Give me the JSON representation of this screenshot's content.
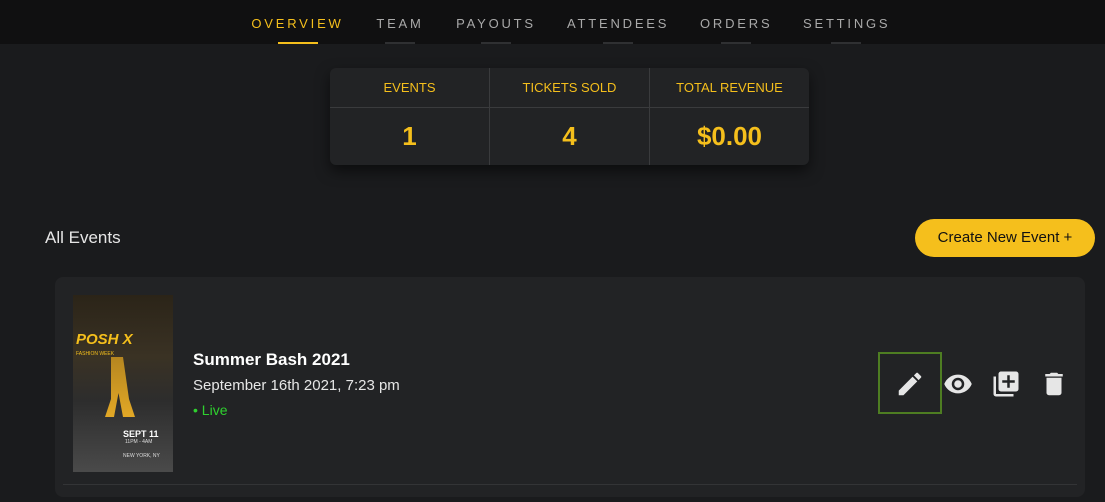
{
  "nav": {
    "tabs": [
      {
        "label": "OVERVIEW",
        "active": true
      },
      {
        "label": "TEAM"
      },
      {
        "label": "PAYOUTS"
      },
      {
        "label": "ATTENDEES"
      },
      {
        "label": "ORDERS"
      },
      {
        "label": "SETTINGS"
      }
    ]
  },
  "stats": [
    {
      "label": "EVENTS",
      "value": "1"
    },
    {
      "label": "TICKETS SOLD",
      "value": "4"
    },
    {
      "label": "TOTAL REVENUE",
      "value": "$0.00"
    }
  ],
  "events_section": {
    "title": "All Events",
    "create_label": "Create New Event +"
  },
  "event": {
    "name": "Summer Bash 2021",
    "datetime": "September 16th 2021, 7:23 pm",
    "status": "• Live",
    "poster": {
      "title": "POSH X",
      "subtitle": "FASHION WEEK",
      "date": "SEPT 11",
      "time": "11PM - 4AM",
      "location": "NEW YORK, NY"
    },
    "actions": [
      "pencil-icon",
      "eye-icon",
      "duplicate-icon",
      "trash-icon"
    ]
  },
  "colors": {
    "accent": "#f5bf1c",
    "background": "#1a1b1d",
    "card": "#222325",
    "live": "#2fd12f",
    "highlight": "#4e7d22"
  }
}
